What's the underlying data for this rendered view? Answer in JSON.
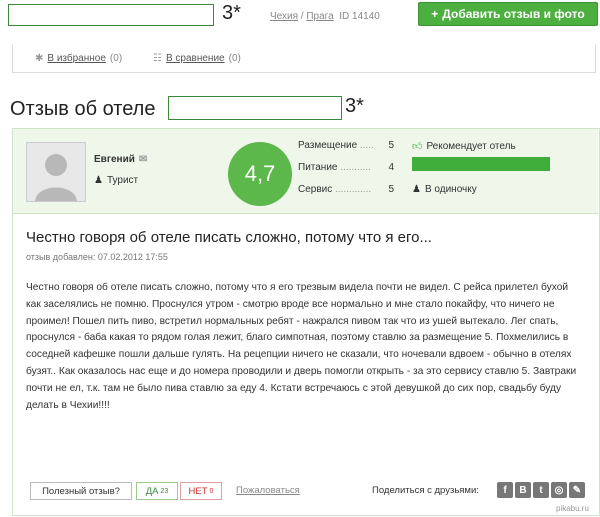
{
  "top": {
    "stars": "3*",
    "crumb_country": "Чехия",
    "crumb_city": "Прага",
    "id_label": "ID 14140",
    "add_button": "Добавить отзыв и фото"
  },
  "favorites": {
    "fav_label": "В избранное",
    "fav_count": "(0)",
    "compare_label": "В сравнение",
    "compare_count": "(0)"
  },
  "review": {
    "title_prefix": "Отзыв об отеле",
    "stars": "3*",
    "user": {
      "name": "Евгений",
      "type": "Турист"
    },
    "score": "4,7",
    "ratings": [
      {
        "label": "Размещение",
        "value": "5"
      },
      {
        "label": "Питание",
        "value": "4"
      },
      {
        "label": "Сервис",
        "value": "5"
      }
    ],
    "recommend": "Рекомендует отель",
    "recommend_level": 1.0,
    "travel": "В одиночку",
    "headline": "Честно говоря об отеле писать сложно, потому что я его...",
    "date": "отзыв добавлен: 07.02.2012 17:55",
    "body": "Честно говоря об отеле писать сложно, потому что я его трезвым видела почти не видел. С рейса прилетел бухой как заселялись не помню. Проснулся утром - смотрю вроде все нормально и мне стало покайфу, что ничего не проимел! Пошел пить пиво, встретил нормальных ребят - нажрался пивом так что из ушей вытекало. Лег спать, проснулся - баба какая то рядом голая лежит, благо симпотная, поэтому ставлю за размещение 5. Похмелились в соседней кафешке пошли дальше гулять. На рецепции ничего не сказали, что ночевали вдвоем - обычно в отелях бузят.. Как оказалось нас еще и до номера проводили и дверь помогли открыть - за это сервису ставлю 5. Завтраки почти не ел, т.к. там не было пива ставлю за еду 4. Кстати встречаюсь с этой девушкой до сих пор, свадьбу буду делать в Чехии!!!!"
  },
  "footer": {
    "helpful": "Полезный отзыв?",
    "yes": "ДА",
    "yes_count": "23",
    "no": "НЕТ",
    "no_count": "0",
    "complain": "Пожаловаться",
    "share": "Поделиться с друзьями:",
    "watermark": "pikabu.ru"
  }
}
